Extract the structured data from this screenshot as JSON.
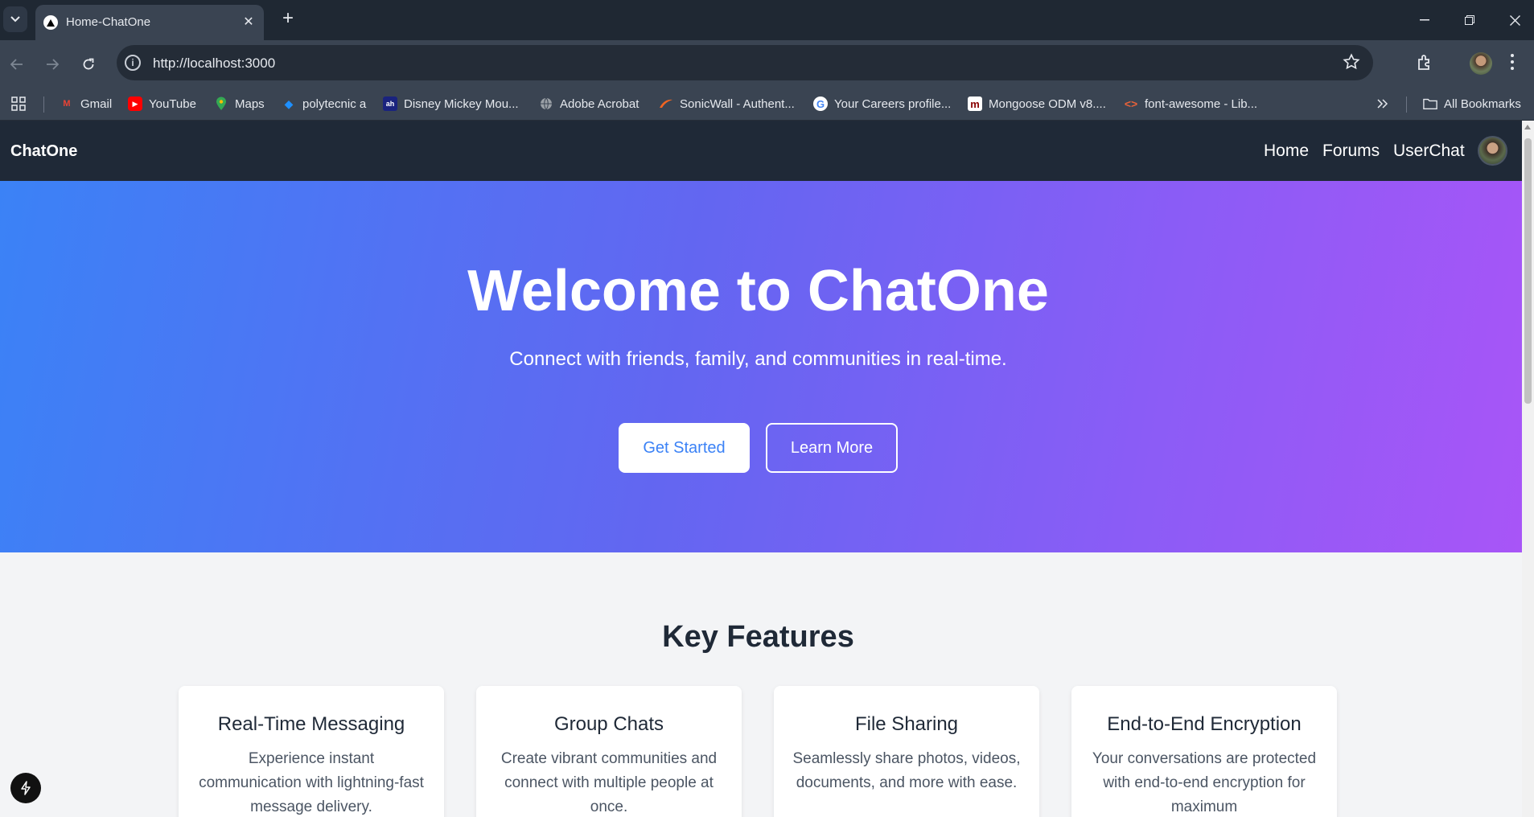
{
  "browser": {
    "tab_title": "Home-ChatOne",
    "url": "http://localhost:3000",
    "bookmarks": [
      {
        "label": "Gmail",
        "icon": "gmail-icon",
        "color": "#ea4335"
      },
      {
        "label": "YouTube",
        "icon": "youtube-icon",
        "color": "#ff0000"
      },
      {
        "label": "Maps",
        "icon": "maps-icon",
        "color": "#34a853"
      },
      {
        "label": "polytecnic a",
        "icon": "polytecnic-icon",
        "color": "#1e90ff"
      },
      {
        "label": "Disney Mickey Mou...",
        "icon": "disney-icon",
        "color": "#1a237e"
      },
      {
        "label": "Adobe Acrobat",
        "icon": "globe-icon",
        "color": "#9aa0a6"
      },
      {
        "label": "SonicWall - Authent...",
        "icon": "sonicwall-icon",
        "color": "#f26522"
      },
      {
        "label": "Your Careers profile...",
        "icon": "google-icon",
        "color": "#4285f4"
      },
      {
        "label": "Mongoose ODM v8....",
        "icon": "mongoose-icon",
        "color": "#880000"
      },
      {
        "label": "font-awesome - Lib...",
        "icon": "code-icon",
        "color": "#e8623a"
      }
    ],
    "all_bookmarks": "All Bookmarks"
  },
  "app": {
    "brand": "ChatOne",
    "nav": [
      "Home",
      "Forums",
      "UserChat"
    ],
    "hero": {
      "title": "Welcome to ChatOne",
      "subtitle": "Connect with friends, family, and communities in real-time.",
      "primary_button": "Get Started",
      "secondary_button": "Learn More"
    },
    "features": {
      "heading": "Key Features",
      "cards": [
        {
          "title": "Real-Time Messaging",
          "text": "Experience instant communication with lightning-fast message delivery."
        },
        {
          "title": "Group Chats",
          "text": "Create vibrant communities and connect with multiple people at once."
        },
        {
          "title": "File Sharing",
          "text": "Seamlessly share photos, videos, documents, and more with ease."
        },
        {
          "title": "End-to-End Encryption",
          "text": "Your conversations are protected with end-to-end encryption for maximum"
        }
      ]
    }
  }
}
